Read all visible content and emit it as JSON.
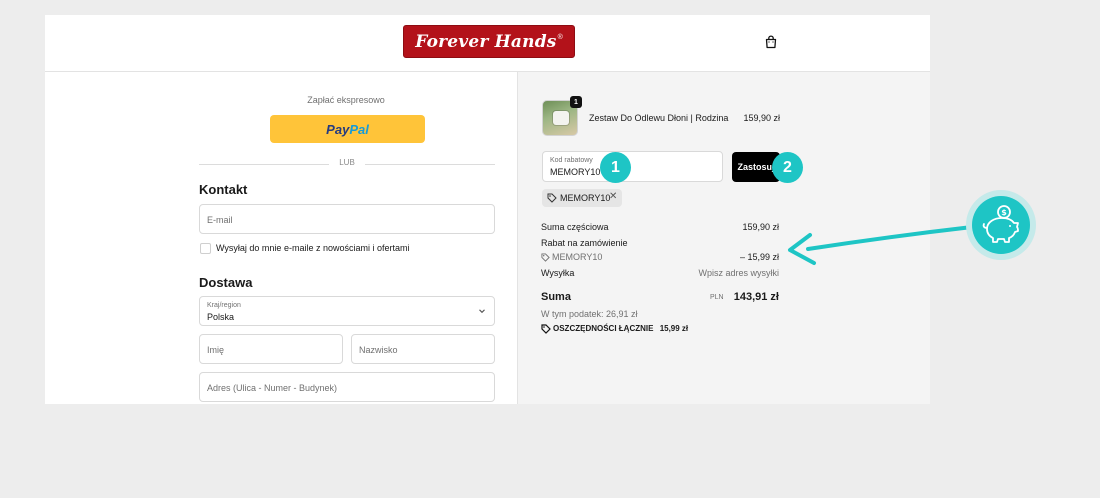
{
  "header": {
    "logo_text": "Forever Hands",
    "logo_mark": "®",
    "cart_icon": "shopping-bag-icon"
  },
  "express": {
    "label": "Zapłać ekspresowo",
    "paypal_left": "Pay",
    "paypal_right": "Pal",
    "or_label": "LUB"
  },
  "contact": {
    "title": "Kontakt",
    "email_placeholder": "E-mail",
    "newsletter_label": "Wysyłaj do mnie e-maile z nowościami i ofertami"
  },
  "delivery": {
    "title": "Dostawa",
    "country_label": "Kraj/region",
    "country_value": "Polska",
    "first_name_placeholder": "Imię",
    "last_name_placeholder": "Nazwisko",
    "address_placeholder": "Adres (Ulica - Numer - Budynek)"
  },
  "summary": {
    "product": {
      "name": "Zestaw Do Odlewu Dłoni | Rodzina",
      "price": "159,90 zł",
      "quantity": "1"
    },
    "discount": {
      "label": "Kod rabatowy",
      "value": "MEMORY10",
      "apply_label": "Zastosuj",
      "step_1": "1",
      "step_2": "2",
      "tag": "MEMORY10",
      "remove_icon": "✕"
    },
    "subtotal_label": "Suma częściowa",
    "subtotal_value": "159,90 zł",
    "order_discount_label": "Rabat na zamówienie",
    "discount_code": "MEMORY10",
    "discount_value": "– 15,99 zł",
    "shipping_label": "Wysyłka",
    "shipping_value": "Wpisz adres wysyłki",
    "total_label": "Suma",
    "total_currency": "PLN",
    "total_value": "143,91 zł",
    "tax_note": "W tym podatek: 26,91 zł",
    "savings_label": "OSZCZĘDNOŚCI ŁĄCZNIE",
    "savings_value": "15,99 zł"
  },
  "annotation": {
    "arrow_color": "#1ec5c5",
    "icon": "piggy-bank-icon"
  }
}
